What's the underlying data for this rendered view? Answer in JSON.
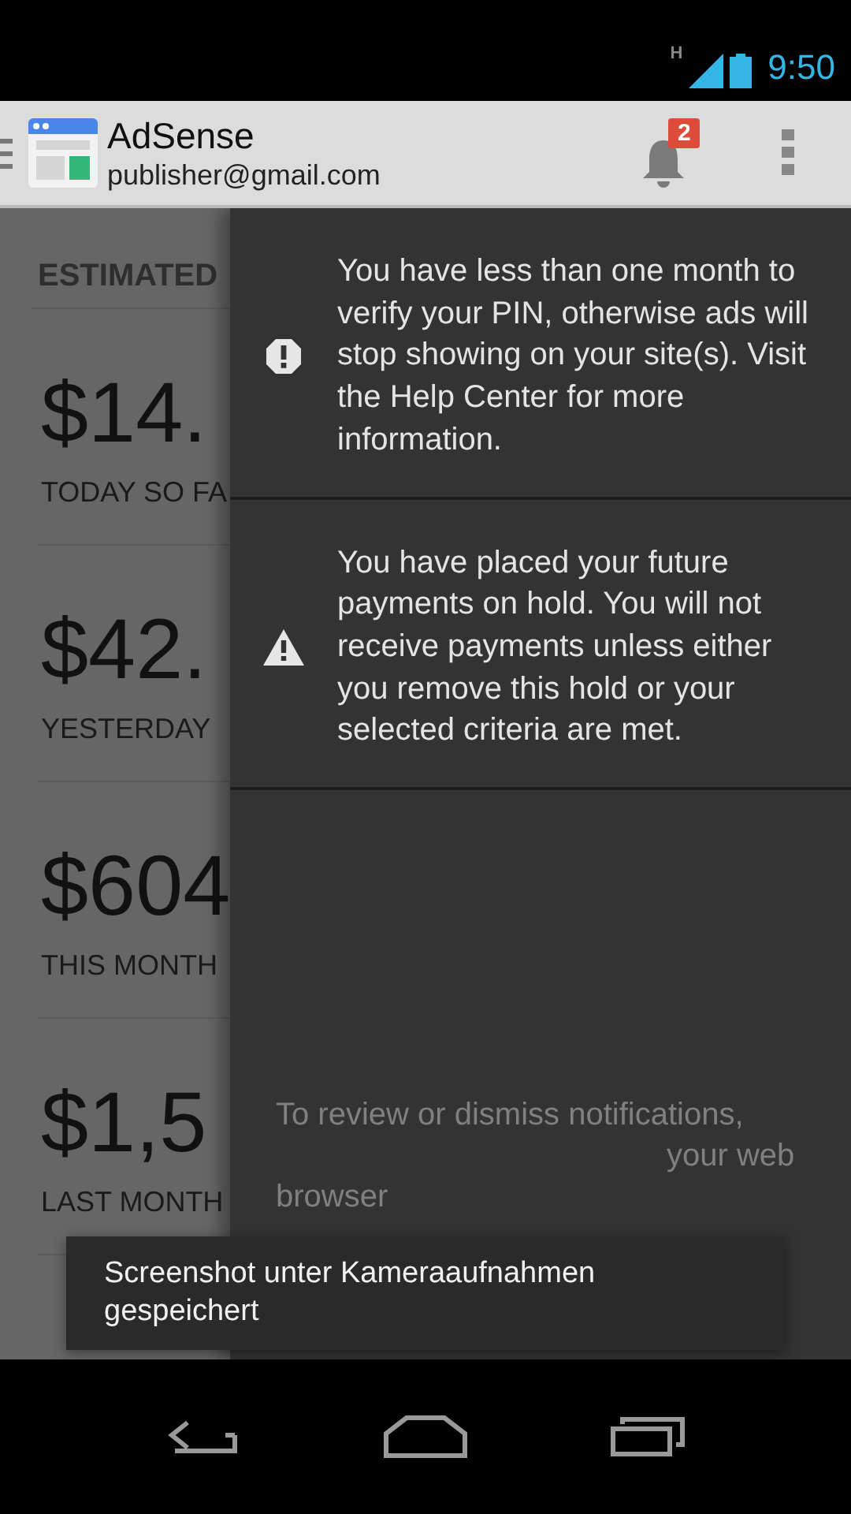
{
  "status_bar": {
    "network": "H",
    "time": "9:50"
  },
  "action_bar": {
    "title": "AdSense",
    "account": "publisher@gmail.com",
    "notification_count": "2"
  },
  "summary": {
    "heading": "ESTIMATED",
    "items": [
      {
        "amount": "$14.",
        "label": "TODAY SO FA"
      },
      {
        "amount": "$42.",
        "label": "YESTERDAY"
      },
      {
        "amount": "$604",
        "label": "THIS MONTH"
      },
      {
        "amount": "$1,5",
        "label": "LAST MONTH"
      }
    ]
  },
  "notifications": [
    {
      "kind": "error",
      "text": "You have less than one month to verify your PIN, otherwise ads will stop showing on your site(s). Visit the Help Center for more information."
    },
    {
      "kind": "warning",
      "text": "You have placed your future payments on hold. You will not receive payments unless either you remove this hold or your selected criteria are met."
    }
  ],
  "footer_lines": [
    "To review or dismiss notifications,",
    "your web",
    "browser"
  ],
  "toast": "Screenshot unter Kameraaufnahmen gespeichert"
}
